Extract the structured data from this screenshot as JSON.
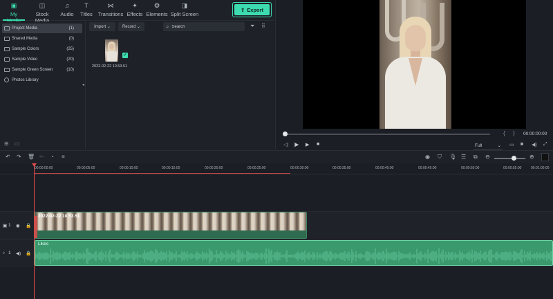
{
  "tabs": [
    {
      "label": "My Media",
      "icon": "media-icon"
    },
    {
      "label": "Stock Media",
      "icon": "stock-media-icon"
    },
    {
      "label": "Audio",
      "icon": "music-note-icon"
    },
    {
      "label": "Titles",
      "icon": "titles-icon"
    },
    {
      "label": "Transitions",
      "icon": "transitions-icon"
    },
    {
      "label": "Effects",
      "icon": "effects-icon"
    },
    {
      "label": "Elements",
      "icon": "elements-icon"
    },
    {
      "label": "Split Screen",
      "icon": "split-screen-icon"
    }
  ],
  "export_label": "Export",
  "sidebar": {
    "items": [
      {
        "label": "Project Media",
        "count": "(1)"
      },
      {
        "label": "Shared Media",
        "count": "(0)"
      },
      {
        "label": "Sample Colors",
        "count": "(25)"
      },
      {
        "label": "Sample Video",
        "count": "(20)"
      },
      {
        "label": "Sample Green Screen",
        "count": "(10)"
      },
      {
        "label": "Photos Library",
        "count": ""
      }
    ]
  },
  "media": {
    "import_label": "Import",
    "record_label": "Record",
    "search_placeholder": "Search",
    "item_label": "2022-02-22 10.53.51"
  },
  "preview": {
    "time": "00:00:00:00",
    "quality": "Full"
  },
  "ruler": {
    "ticks": [
      "00:00:00:00",
      "00:00:05:00",
      "00:00:10:00",
      "00:00:15:00",
      "00:00:20:00",
      "00:00:25:00",
      "00:00:30:00",
      "00:00:35:00",
      "00:00:40:00",
      "00:00:45:00",
      "00:00:50:00",
      "00:00:55:00",
      "00:01:00:00"
    ]
  },
  "tracks": {
    "video_num": "1",
    "audio_num": "1",
    "video_clip_title": "2022-02-22 10.53.51",
    "audio_clip_title": "Likes"
  },
  "colors": {
    "accent": "#3ddbb0",
    "playhead": "#e24b4b",
    "audio_clip": "#3a9a6e"
  }
}
